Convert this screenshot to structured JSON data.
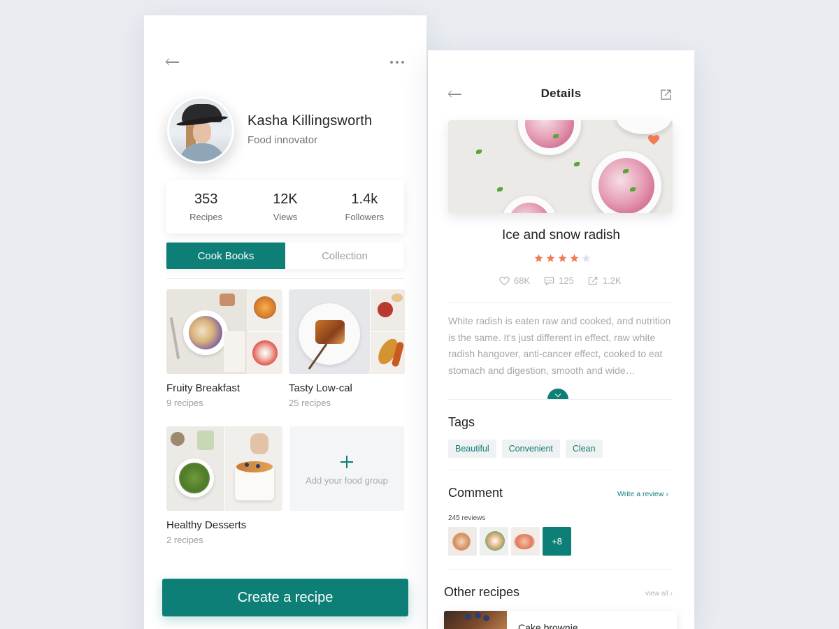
{
  "profile": {
    "name": "Kasha Killingsworth",
    "role": "Food innovator",
    "stats": [
      {
        "value": "353",
        "label": "Recipes"
      },
      {
        "value": "12K",
        "label": "Views"
      },
      {
        "value": "1.4k",
        "label": "Followers"
      }
    ],
    "tabs": [
      {
        "label": "Cook Books",
        "active": true
      },
      {
        "label": "Collection",
        "active": false
      }
    ],
    "books": [
      {
        "title": "Fruity Breakfast",
        "count": "9 recipes"
      },
      {
        "title": "Tasty Low-cal",
        "count": "25 recipes"
      },
      {
        "title": "Healthy Desserts",
        "count": "2 recipes"
      }
    ],
    "add_group_label": "Add your food group",
    "create_button": "Create a recipe"
  },
  "details": {
    "header_title": "Details",
    "recipe_title": "Ice and snow radish",
    "rating": 4,
    "rating_max": 5,
    "likes": "68K",
    "comments": "125",
    "shares": "1.2K",
    "description": "White radish is eaten raw and cooked, and nutrition is the same. It's just different in effect, raw white radish hangover, anti-cancer effect, cooked to eat stomach and digestion, smooth and wide…",
    "tags_title": "Tags",
    "tags": [
      "Beautiful",
      "Convenient",
      "Clean"
    ],
    "comment_title": "Comment",
    "write_review": "Write a review",
    "reviews_count": "245 reviews",
    "more_thumbs": "+8",
    "other_title": "Other recipes",
    "view_all": "view all",
    "other_recipe_name": "Cake brownie"
  },
  "colors": {
    "accent": "#0d7f77",
    "star": "#f07a55",
    "star_empty": "#dfe2e5",
    "background": "#e9ecf1"
  }
}
